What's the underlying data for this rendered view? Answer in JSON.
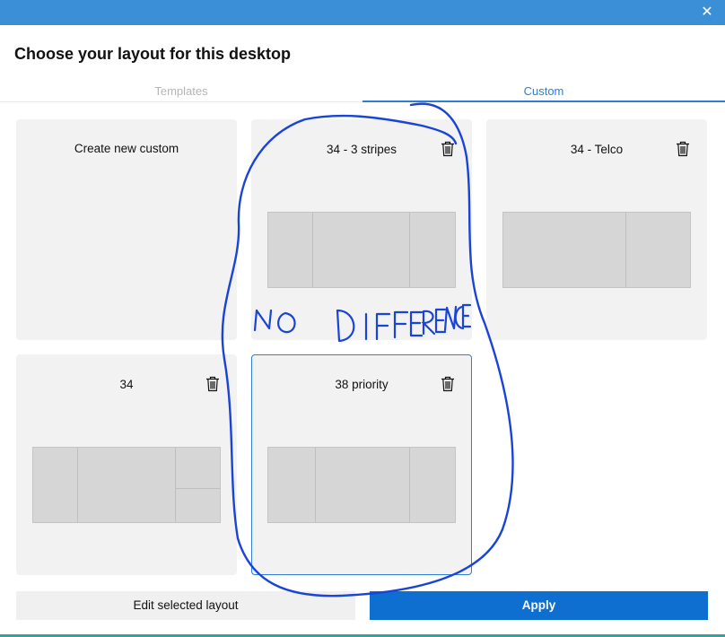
{
  "window": {
    "close_glyph": "✕"
  },
  "dialog": {
    "title": "Choose your layout for this desktop"
  },
  "tabs": [
    {
      "label": "Templates",
      "active": false
    },
    {
      "label": "Custom",
      "active": true
    }
  ],
  "layouts": [
    {
      "title": "Create new custom",
      "has_delete": false,
      "selected": false
    },
    {
      "title": "34 - 3 stripes",
      "has_delete": true,
      "selected": false
    },
    {
      "title": "34 - Telco",
      "has_delete": true,
      "selected": false
    },
    {
      "title": "34",
      "has_delete": true,
      "selected": false
    },
    {
      "title": "38 priority",
      "has_delete": true,
      "selected": true
    }
  ],
  "actions": {
    "edit_label": "Edit selected layout",
    "apply_label": "Apply"
  },
  "annotation": {
    "text": "NO DIFFERENCE",
    "color": "#1a44d6"
  },
  "colors": {
    "titlebar": "#3a8fd6",
    "accent": "#2d7fd1",
    "apply": "#0f6fd1"
  }
}
